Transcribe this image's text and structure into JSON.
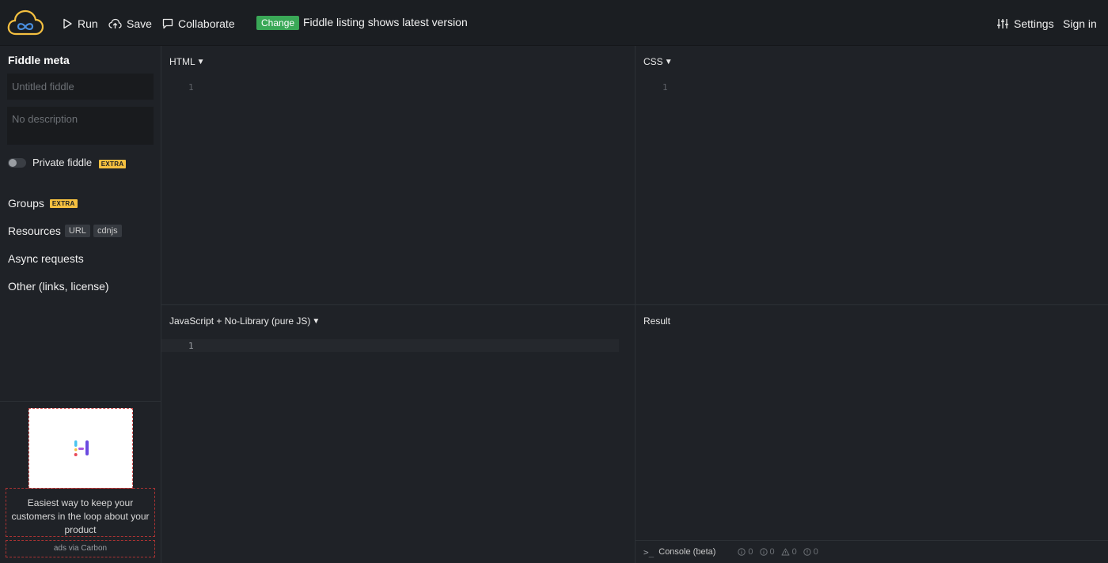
{
  "topbar": {
    "run_label": "Run",
    "save_label": "Save",
    "collaborate_label": "Collaborate",
    "change_badge": "Change",
    "change_text": "Fiddle listing shows latest version",
    "settings_label": "Settings",
    "signin_label": "Sign in"
  },
  "sidebar": {
    "title": "Fiddle meta",
    "title_placeholder": "Untitled fiddle",
    "description_placeholder": "No description",
    "private_label": "Private fiddle",
    "extra_badge": "EXTRA",
    "items": [
      {
        "label": "Groups"
      },
      {
        "label": "Resources",
        "tags": [
          "URL",
          "cdnjs"
        ]
      },
      {
        "label": "Async requests"
      },
      {
        "label": "Other (links, license)"
      }
    ]
  },
  "ad": {
    "text": "Easiest way to keep your customers in the loop about your product",
    "via": "ads via Carbon"
  },
  "panels": {
    "html": {
      "label": "HTML",
      "line": "1"
    },
    "css": {
      "label": "CSS",
      "line": "1"
    },
    "js": {
      "label": "JavaScript + No-Library (pure JS)",
      "line": "1"
    },
    "result": {
      "label": "Result"
    }
  },
  "console": {
    "prompt": ">_",
    "label": "Console (beta)",
    "counts": [
      "0",
      "0",
      "0",
      "0"
    ]
  },
  "colors": {
    "accent_yellow": "#f5c040",
    "change_green": "#3aa857",
    "background": "#1f2227"
  }
}
